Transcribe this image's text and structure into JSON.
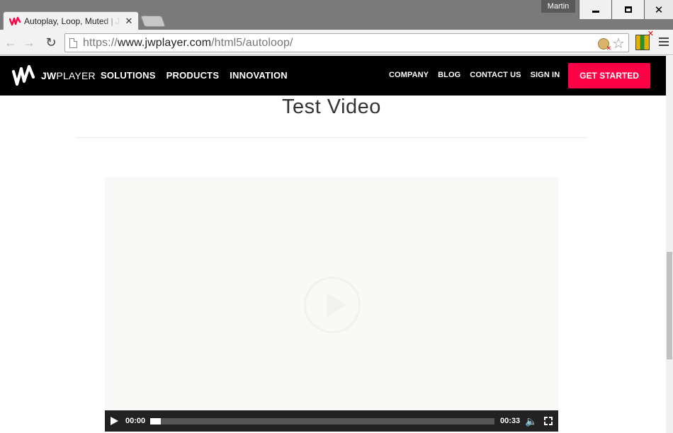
{
  "browser": {
    "tab": {
      "title": "Autoplay, Loop, Muted | JW",
      "close": "✕"
    },
    "profile_name": "Martin",
    "window_controls": {
      "close": "✕"
    },
    "address_bar": {
      "scheme": "https://",
      "host": "www.jwplayer.com",
      "path": "/html5/autoloop/"
    },
    "icons": [
      "jwplayer-favicon-icon",
      "back-arrow-icon",
      "forward-arrow-icon",
      "reload-icon",
      "page-icon",
      "extension-icon",
      "star-icon",
      "menu-icon"
    ]
  },
  "site": {
    "logo": {
      "jw": "JW",
      "player": "PLAYER"
    },
    "nav_main": [
      "SOLUTIONS",
      "PRODUCTS",
      "INNOVATION"
    ],
    "nav_right": [
      "COMPANY",
      "BLOG",
      "CONTACT US",
      "SIGN IN"
    ],
    "cta": "GET STARTED",
    "accent": "#ff0046"
  },
  "content": {
    "heading": "Test Video"
  },
  "player": {
    "current_time": "00:00",
    "duration": "00:33",
    "progress": 0.03,
    "icons": [
      "play-icon",
      "volume-icon",
      "fullscreen-icon"
    ]
  }
}
